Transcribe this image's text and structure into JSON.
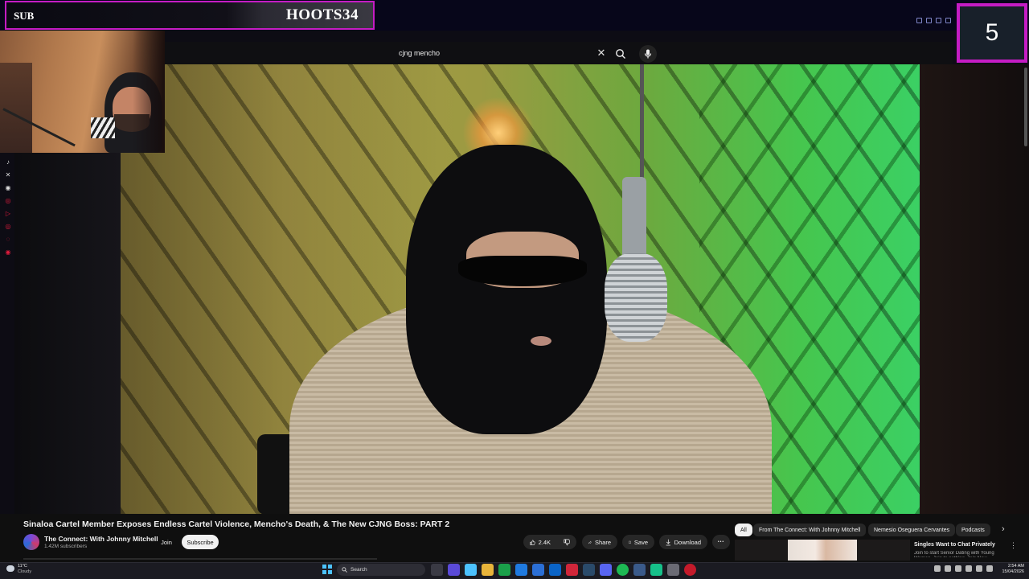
{
  "overlay": {
    "sub_label": "SUB",
    "streamer_name": "HOOTS34",
    "counter": "5"
  },
  "search": {
    "query": "cjng mencho",
    "clear_glyph": "✕"
  },
  "video": {
    "title": "Sinaloa Cartel Member Exposes Endless Cartel Violence, Mencho's Death, & The New CJNG Boss: PART 2"
  },
  "channel": {
    "name": "The Connect: With Johnny Mitchell",
    "subscribers": "1.42M subscribers",
    "join_label": "Join",
    "subscribe_label": "Subscribe"
  },
  "actions": {
    "like_count": "2.4K",
    "share_label": "Share",
    "save_label": "Save",
    "download_label": "Download",
    "more_glyph": "•••"
  },
  "chips": [
    {
      "label": "All"
    },
    {
      "label": "From The Connect: With Johnny Mitchell"
    },
    {
      "label": "Nemesio Oseguera Cervantes"
    },
    {
      "label": "Podcasts"
    }
  ],
  "chips_next_glyph": "›",
  "recommendation": {
    "title": "Singles Want to Chat Privately",
    "description": "Join to start Senior Dating with Young Women. Join to nothing. Join Now."
  },
  "social_icons": [
    "tiktok-icon",
    "x-icon",
    "discord-icon",
    "instagram-icon",
    "youtube-icon",
    "instagram-icon",
    "snapchat-icon",
    "pinterest-icon"
  ],
  "taskbar": {
    "weather_temp": "11°C",
    "weather_desc": "Cloudy",
    "search_label": "Search",
    "time": "2:54 AM",
    "date": "15/04/2026"
  },
  "colors": {
    "overlay_accent": "#c51cc4",
    "youtube_red": "#e01b3c",
    "windows_blue": "#4cc2ff"
  }
}
